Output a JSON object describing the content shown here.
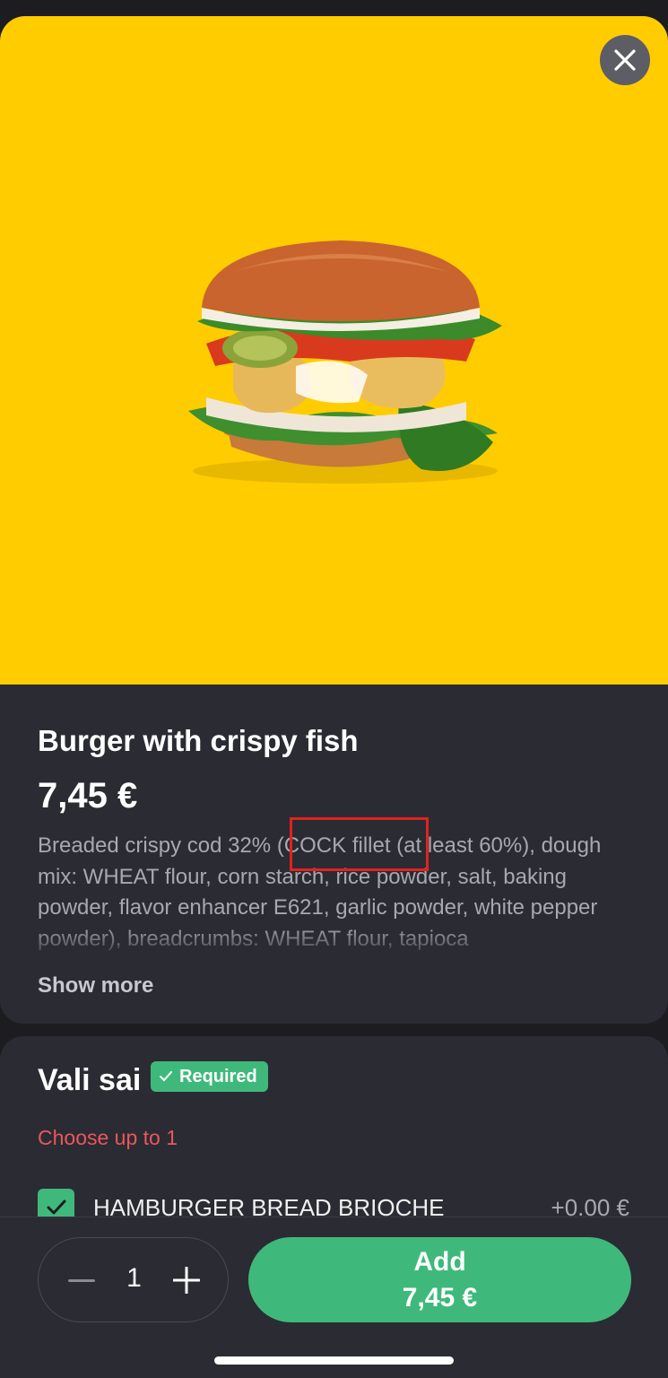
{
  "product": {
    "title": "Burger with crispy fish",
    "price": "7,45 €",
    "description": "Breaded crispy cod 32% (COCK fillet (at least 60%), dough mix: WHEAT flour, corn starch, rice powder, salt, baking powder, flavor enhancer E621, garlic powder, white pepper powder), breadcrumbs: WHEAT flour, tapioca",
    "show_more": "Show more",
    "image_icon": "burger-photo"
  },
  "option_group": {
    "title": "Vali sai",
    "badge": "Required",
    "hint": "Choose up to 1",
    "items": [
      {
        "label": "HAMBURGER BREAD BRIOCHE",
        "price": "+0.00 €",
        "checked": true
      }
    ]
  },
  "cart": {
    "quantity": "1",
    "add_label": "Add",
    "add_price": "7,45 €"
  },
  "colors": {
    "hero_bg": "#ffcc00",
    "accent": "#3fb97b",
    "card_bg": "#2b2b33",
    "hint": "#e8585c",
    "annotation": "#e0231c"
  }
}
